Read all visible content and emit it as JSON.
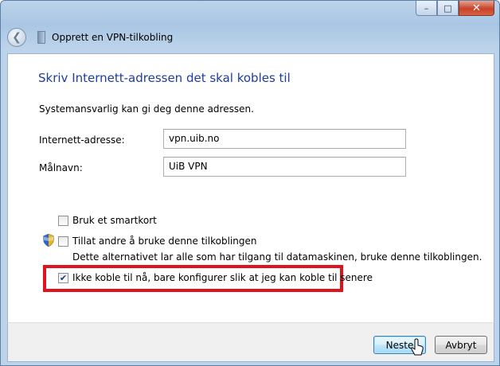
{
  "window": {
    "title": "Opprett en VPN-tilkobling",
    "caption_buttons": {
      "minimize": "–",
      "maximize": "□",
      "close": "✕"
    }
  },
  "nav": {
    "back_icon": "back-arrow-icon",
    "back_glyph": "❮"
  },
  "main": {
    "heading": "Skriv Internett-adressen det skal kobles til",
    "info": "Systemansvarlig kan gi deg denne adressen.",
    "address_label": "Internett-adresse:",
    "address_value": "vpn.uib.no",
    "destination_label": "Målnavn:",
    "destination_value": "UiB VPN",
    "smartcard": {
      "label": "Bruk et smartkort",
      "checked": false
    },
    "allow_others": {
      "label": "Tillat andre å bruke denne tilkoblingen",
      "checked": false,
      "description": "Dette alternativet lar alle som har tilgang til datamaskinen, bruke denne tilkoblingen."
    },
    "dont_connect": {
      "label": "Ikke koble til nå, bare konfigurer slik at jeg kan koble til senere",
      "checked": true,
      "check_glyph": "✔"
    }
  },
  "footer": {
    "next": "Neste",
    "cancel": "Avbryt"
  },
  "colors": {
    "heading": "#1e3d9c",
    "highlight": "#e1121b"
  }
}
